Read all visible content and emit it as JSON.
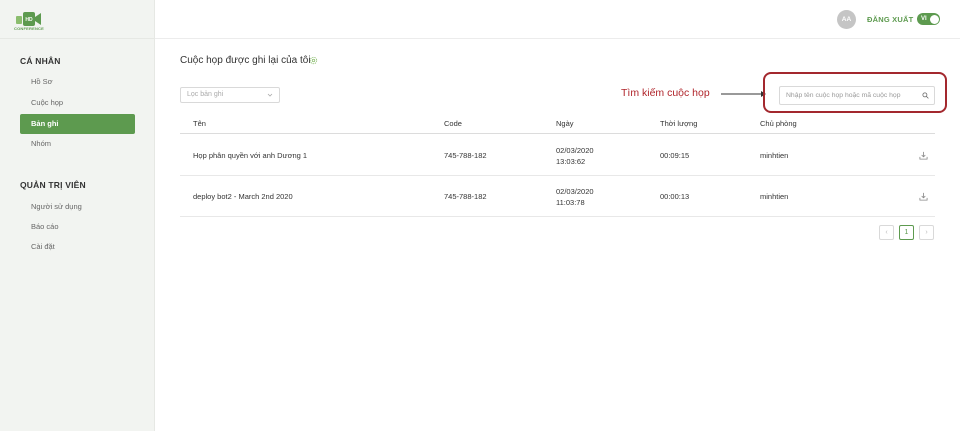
{
  "sidebar": {
    "logo_text": "CONFERENCE",
    "personal_title": "CÁ NHÂN",
    "personal_items": [
      {
        "label": "Hồ Sơ"
      },
      {
        "label": "Cuộc họp"
      },
      {
        "label": "Bản ghi",
        "active": true
      },
      {
        "label": "Nhóm"
      }
    ],
    "admin_title": "QUẢN TRỊ VIÊN",
    "admin_items": [
      {
        "label": "Người sử dụng"
      },
      {
        "label": "Báo cáo"
      },
      {
        "label": "Cài đặt"
      }
    ]
  },
  "header": {
    "avatar_initials": "AA",
    "logout_label": "ĐĂNG XUẤT",
    "language_toggle": "VI"
  },
  "main": {
    "title": "Cuộc họp được ghi lại của tôi",
    "filter_placeholder": "Lọc bản ghi",
    "search_placeholder": "Nhập tên cuộc họp hoặc mã cuộc họp",
    "annotation_label": "Tìm kiếm cuộc họp",
    "table": {
      "columns": [
        "Tên",
        "Code",
        "Ngày",
        "Thời lượng",
        "Chủ phòng"
      ],
      "rows": [
        {
          "name": "Họp phân quyền với anh Dương 1",
          "code": "745-788-182",
          "date": "02/03/2020",
          "time": "13:03:62",
          "duration": "00:09:15",
          "host": "minhtien"
        },
        {
          "name": "deploy bot2 - March 2nd 2020",
          "code": "745-788-182",
          "date": "02/03/2020",
          "time": "11:03:78",
          "duration": "00:00:13",
          "host": "minhtien"
        }
      ]
    },
    "pagination": {
      "prev": "‹",
      "current": "1",
      "next": "›"
    }
  },
  "colors": {
    "accent": "#5d9a4f",
    "annotation": "#b0252b"
  },
  "icons": [
    "logo-camera-icon",
    "settings-icon",
    "chevron-down-icon",
    "search-icon",
    "download-icon",
    "arrow-annotation-icon"
  ]
}
